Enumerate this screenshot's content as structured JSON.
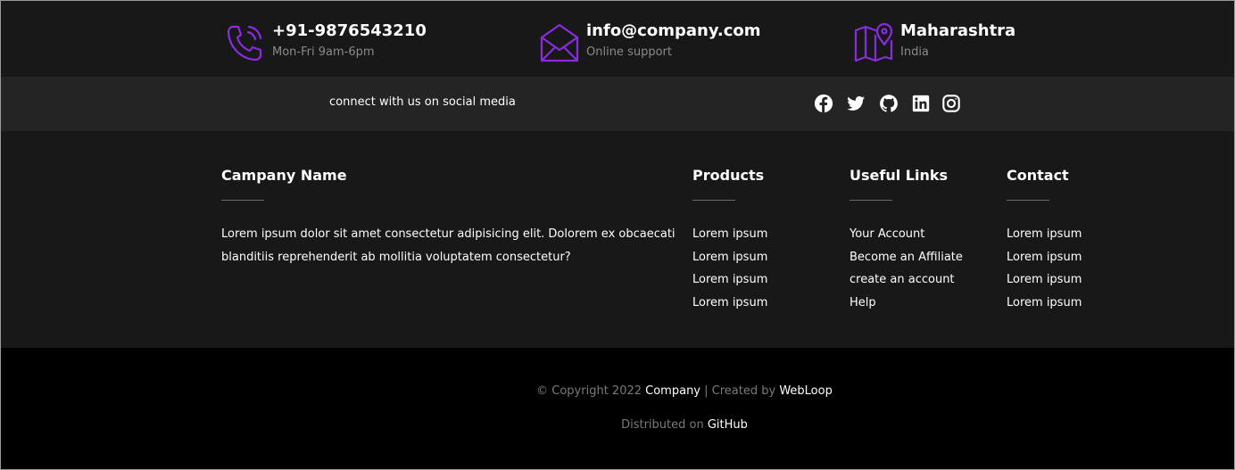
{
  "colors": {
    "accent": "#8a2be2",
    "band_dark": "#181818",
    "band_social": "#242424",
    "band_bottom": "#000000"
  },
  "contacts": [
    {
      "icon": "phone-icon",
      "title": "+91-9876543210",
      "subtitle": "Mon-Fri 9am-6pm"
    },
    {
      "icon": "envelope-icon",
      "title": "info@company.com",
      "subtitle": "Online support"
    },
    {
      "icon": "map-pin-icon",
      "title": "Maharashtra",
      "subtitle": "India"
    }
  ],
  "social": {
    "text": "connect with us on social media",
    "icons": [
      "facebook-icon",
      "twitter-icon",
      "github-icon",
      "linkedin-icon",
      "instagram-icon"
    ]
  },
  "about": {
    "title": "Campany Name",
    "text": "Lorem ipsum dolor sit amet consectetur adipisicing elit. Dolorem ex obcaecati blanditiis reprehenderit ab mollitia voluptatem consectetur?"
  },
  "products": {
    "title": "Products",
    "links": [
      "Lorem ipsum",
      "Lorem ipsum",
      "Lorem ipsum",
      "Lorem ipsum"
    ]
  },
  "useful_links": {
    "title": "Useful Links",
    "links": [
      "Your Account",
      "Become an Affiliate",
      "create an account",
      "Help"
    ]
  },
  "contact": {
    "title": "Contact",
    "links": [
      "Lorem ipsum",
      "Lorem ipsum",
      "Lorem ipsum",
      "Lorem ipsum"
    ]
  },
  "copyright": {
    "prefix": "© Copyright 2022 ",
    "company": "Company",
    "middle": " | Created by ",
    "creator": "WebLoop",
    "distributed_prefix": "Distributed on ",
    "distributed_link": "GitHub"
  }
}
